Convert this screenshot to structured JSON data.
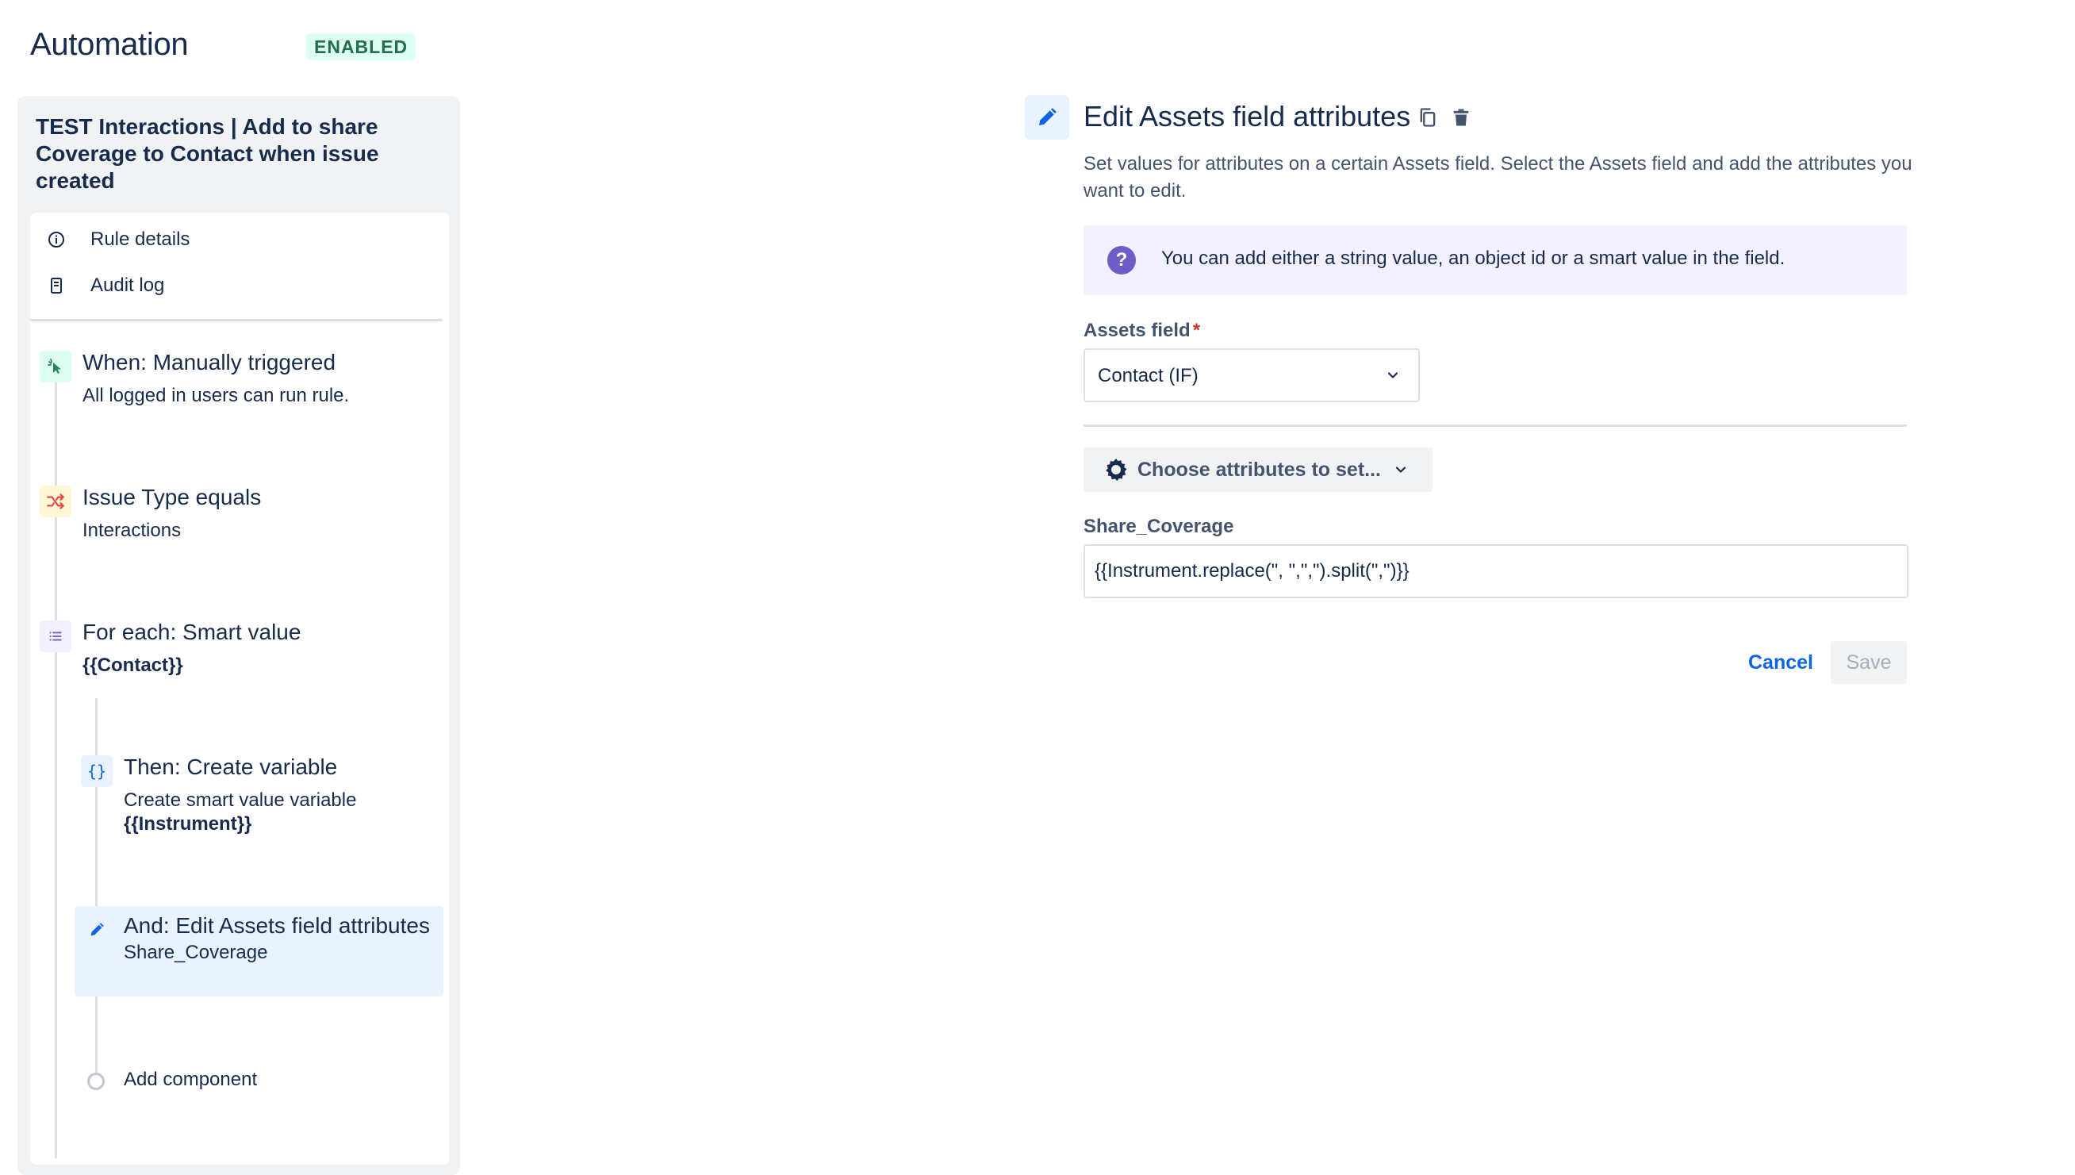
{
  "header": {
    "title": "Automation",
    "status_badge": "ENABLED"
  },
  "rule": {
    "title": "TEST Interactions | Add to share Coverage to Contact when issue created",
    "menu": [
      {
        "label": "Rule details",
        "icon": "info-icon"
      },
      {
        "label": "Audit log",
        "icon": "document-icon"
      }
    ],
    "steps": [
      {
        "title": "When: Manually triggered",
        "sub": "All logged in users can run rule.",
        "icon": "cursor-click-icon"
      },
      {
        "title": "Issue Type equals",
        "sub": "Interactions",
        "icon": "shuffle-icon"
      },
      {
        "title": "For each: Smart value",
        "sub": "{{Contact}}",
        "icon": "list-icon"
      },
      {
        "title": "Then: Create variable",
        "sub": "Create smart value variable",
        "sub2": "{{Instrument}}",
        "icon": "braces-icon"
      },
      {
        "title": "And: Edit Assets field attributes",
        "sub": "Share_Coverage",
        "icon": "pencil-icon"
      }
    ],
    "add_component": "Add component"
  },
  "editor": {
    "title": "Edit Assets field attributes",
    "description": "Set values for attributes on a certain Assets field. Select the Assets field and add the attributes you want to edit.",
    "info_message": "You can add either a string value, an object id or a smart value in the field.",
    "assets_field_label": "Assets field",
    "required_marker": "*",
    "assets_field_value": "Contact (IF)",
    "choose_attributes_label": "Choose attributes to set...",
    "attribute_label": "Share_Coverage",
    "attribute_value": "{{Instrument.replace(\", \",\",\").split(\",\")}}",
    "cancel_label": "Cancel",
    "save_label": "Save"
  },
  "colors": {
    "accent": "#0c66e4",
    "badge_bg": "#dcfff1",
    "badge_text": "#216e4e",
    "info_bg": "#f3f0ff",
    "info_icon": "#6e5dc6",
    "selected_bg": "#e9f2ff"
  }
}
